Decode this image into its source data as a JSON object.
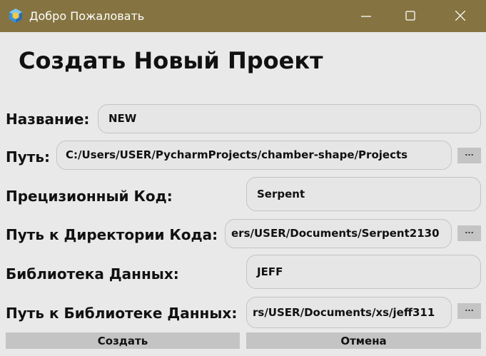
{
  "window": {
    "title": "Добро Пожаловать",
    "titlebar_color": "#857441",
    "icons": {
      "app": "app-hexagon-icon",
      "minimize": "minimize-icon",
      "maximize": "maximize-icon",
      "close": "close-icon"
    }
  },
  "heading": "Создать Новый Проект",
  "form": {
    "name_label": "Название:",
    "name_value": "NEW",
    "path_label": "Путь:",
    "path_value": "C:/Users/USER/PycharmProjects/chamber-shape/Projects",
    "path_browse": "...",
    "code_label": "Прецизионный Код:",
    "code_value": "Serpent",
    "code_dir_label": "Путь к Директории Кода:",
    "code_dir_value": "ers/USER/Documents/Serpent2130",
    "code_dir_browse": "...",
    "library_label": "Библиотека Данных:",
    "library_value": "JEFF",
    "library_path_label": "Путь к Библиотеке Данных:",
    "library_path_value": "rs/USER/Documents/xs/jeff311",
    "library_path_browse": "..."
  },
  "buttons": {
    "create": "Создать",
    "cancel": "Отмена"
  }
}
